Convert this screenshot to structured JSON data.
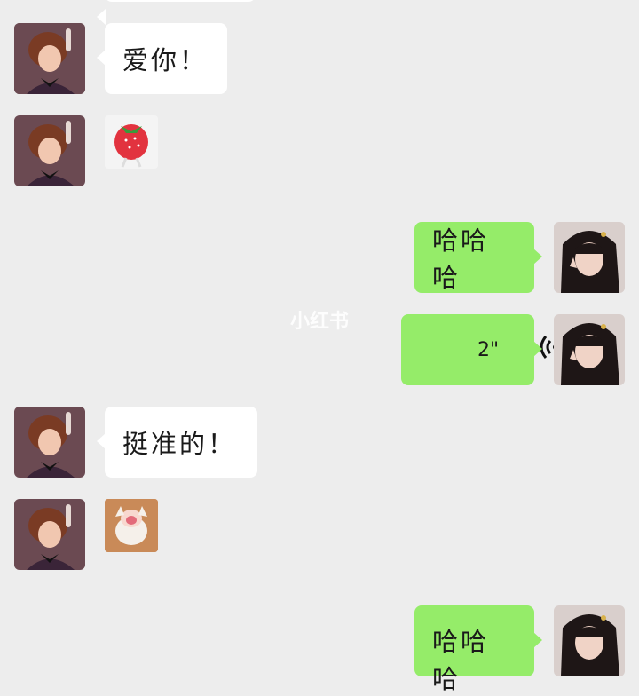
{
  "watermark": "小红书",
  "messages": [
    {
      "side": "left",
      "type": "text",
      "text": "爱你！"
    },
    {
      "side": "left",
      "type": "sticker",
      "sticker": "strawberry-sticker"
    },
    {
      "side": "right",
      "type": "text",
      "text": "哈哈哈"
    },
    {
      "side": "right",
      "type": "voice",
      "duration": "2\"",
      "icon": "voice-wave-icon"
    },
    {
      "side": "left",
      "type": "text",
      "text": "挺准的！"
    },
    {
      "side": "left",
      "type": "sticker",
      "sticker": "laughing-cat-sticker"
    },
    {
      "side": "right",
      "type": "text",
      "text": "哈哈哈"
    }
  ],
  "colors": {
    "background": "#ededed",
    "sent_bubble": "#95ec69",
    "received_bubble": "#ffffff"
  }
}
